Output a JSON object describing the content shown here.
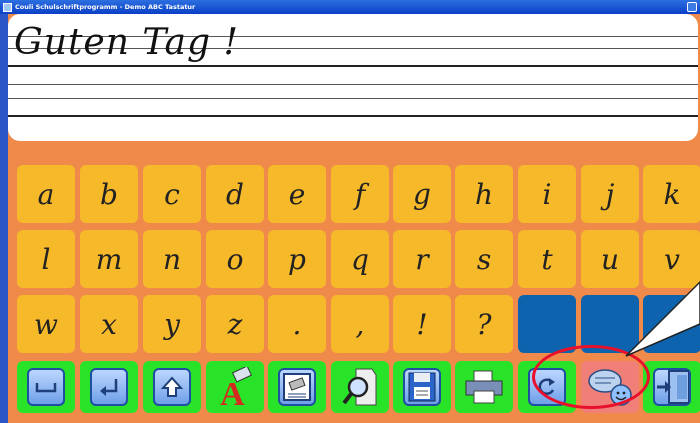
{
  "window": {
    "title": "Couli Schulschriftprogramm - Demo ABC Tastatur"
  },
  "writing_area": {
    "text": "Guten Tag !"
  },
  "keyboard": {
    "rows": [
      [
        "a",
        "b",
        "c",
        "d",
        "e",
        "f",
        "g",
        "h",
        "i",
        "j",
        "k"
      ],
      [
        "l",
        "m",
        "n",
        "o",
        "p",
        "q",
        "r",
        "s",
        "t",
        "u",
        "v"
      ],
      [
        "w",
        "x",
        "y",
        "z",
        ".",
        ",",
        "!",
        "?",
        "",
        "",
        ""
      ]
    ]
  },
  "toolbar": {
    "tools": [
      {
        "name": "space-key-button",
        "icon": "space-bar-icon"
      },
      {
        "name": "enter-key-button",
        "icon": "enter-arrow-icon"
      },
      {
        "name": "shift-key-button",
        "icon": "shift-arrow-icon"
      },
      {
        "name": "font-eraser-button",
        "icon": "letter-a-eraser-icon"
      },
      {
        "name": "clear-text-button",
        "icon": "eraser-document-icon"
      },
      {
        "name": "preview-button",
        "icon": "document-magnifier-icon"
      },
      {
        "name": "save-button",
        "icon": "floppy-disk-icon"
      },
      {
        "name": "print-button",
        "icon": "printer-icon"
      },
      {
        "name": "refresh-button",
        "icon": "refresh-icon"
      },
      {
        "name": "speech-button",
        "icon": "speech-bubble-smiley-icon"
      },
      {
        "name": "exit-button",
        "icon": "exit-door-icon"
      }
    ]
  },
  "colors": {
    "background": "#f08a4b",
    "key_yellow": "#f6b92a",
    "key_blue": "#0d63ad",
    "tool_green": "#28e328",
    "tool_active": "#f07f78",
    "highlight_red": "#e8102a"
  }
}
